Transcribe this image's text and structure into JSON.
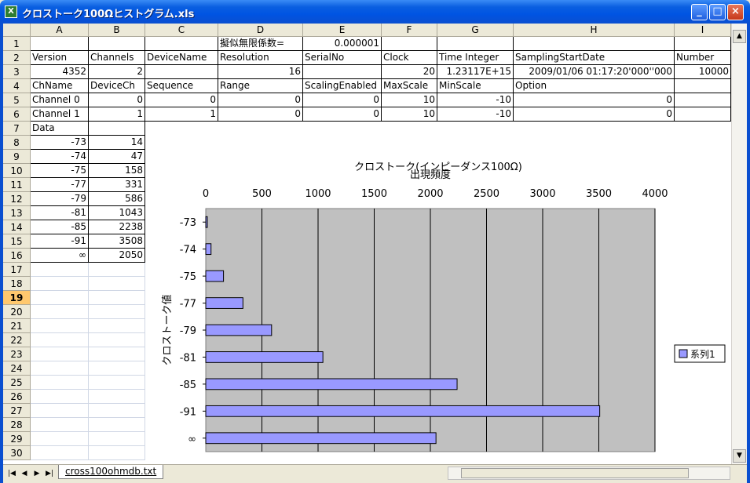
{
  "window": {
    "title": "クロストーク100Ωヒストグラム.xls",
    "app_icon": "X"
  },
  "columns": [
    "A",
    "B",
    "C",
    "D",
    "E",
    "F",
    "G",
    "H",
    "I"
  ],
  "rows": [
    "1",
    "2",
    "3",
    "4",
    "5",
    "6",
    "7",
    "8",
    "9",
    "10",
    "11",
    "12",
    "13",
    "14",
    "15",
    "16",
    "17",
    "18",
    "19",
    "20",
    "21",
    "22",
    "23",
    "24",
    "25",
    "26",
    "27",
    "28",
    "29",
    "30"
  ],
  "selected_row": "19",
  "sheet": {
    "r1": {
      "D": "擬似無限係数=",
      "E": "0.000001"
    },
    "r2": {
      "A": "Version",
      "B": "Channels",
      "C": "DeviceName",
      "D": "Resolution",
      "E": "SerialNo",
      "F": "Clock",
      "G": "Time Integer",
      "H": "SamplingStartDate",
      "I": "Number"
    },
    "r3": {
      "A": "4352",
      "B": "2",
      "C": "",
      "D": "16",
      "E": "",
      "F": "20",
      "G": "1.23117E+15",
      "H": "2009/01/06 01:17:20'000''000",
      "I": "10000"
    },
    "r4": {
      "A": "ChName",
      "B": "DeviceCh",
      "C": "Sequence",
      "D": "Range",
      "E": "ScalingEnabled",
      "F": "MaxScale",
      "G": "MinScale",
      "H": "Option",
      "I": ""
    },
    "r5": {
      "A": "Channel 0",
      "B": "0",
      "C": "0",
      "D": "0",
      "E": "0",
      "F": "10",
      "G": "-10",
      "H": "0",
      "I": ""
    },
    "r6": {
      "A": "Channel 1",
      "B": "1",
      "C": "1",
      "D": "0",
      "E": "0",
      "F": "10",
      "G": "-10",
      "H": "0",
      "I": ""
    },
    "r7": {
      "A": "Data",
      "B": ""
    },
    "data_rows": [
      {
        "A": "-73",
        "B": "14"
      },
      {
        "A": "-74",
        "B": "47"
      },
      {
        "A": "-75",
        "B": "158"
      },
      {
        "A": "-77",
        "B": "331"
      },
      {
        "A": "-79",
        "B": "586"
      },
      {
        "A": "-81",
        "B": "1043"
      },
      {
        "A": "-85",
        "B": "2238"
      },
      {
        "A": "-91",
        "B": "3508"
      },
      {
        "A": "∞",
        "B": "2050"
      }
    ]
  },
  "sheet_tab": "cross100ohmdb.txt",
  "colors": {
    "bar": "#9999ff",
    "plot_bg": "#c0c0c0",
    "titlebar": "#0054e3"
  },
  "chart_data": {
    "type": "bar",
    "orientation": "horizontal",
    "title": "クロストーク(インピーダンス100Ω)",
    "xlabel": "出現頻度",
    "ylabel": "クロストーク値",
    "categories": [
      "-73",
      "-74",
      "-75",
      "-77",
      "-79",
      "-81",
      "-85",
      "-91",
      "∞"
    ],
    "series": [
      {
        "name": "系列1",
        "values": [
          14,
          47,
          158,
          331,
          586,
          1043,
          2238,
          3508,
          2050
        ]
      }
    ],
    "xlim": [
      0,
      4000
    ],
    "xticks": [
      "0",
      "500",
      "1000",
      "1500",
      "2000",
      "2500",
      "3000",
      "3500",
      "4000"
    ],
    "x_axis_position": "top",
    "grid": true,
    "legend": "right"
  }
}
